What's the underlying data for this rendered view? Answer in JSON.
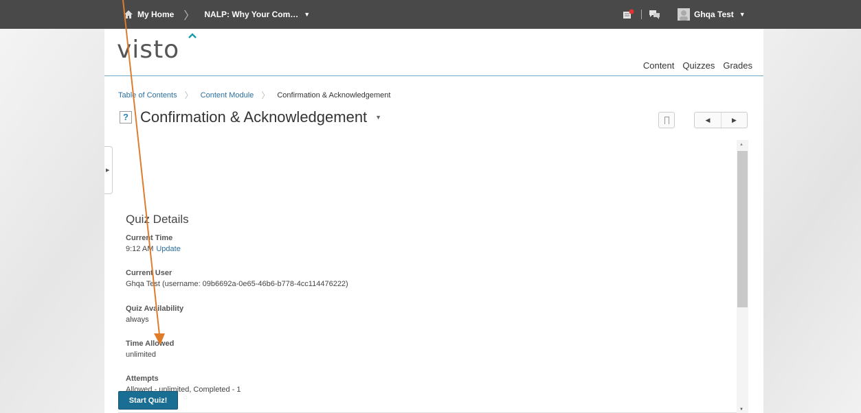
{
  "topbar": {
    "home_label": "My Home",
    "course_label": "NALP: Why Your Com…",
    "user_name": "Ghqa Test"
  },
  "logo": {
    "text": "visto"
  },
  "nav": {
    "items": [
      "Content",
      "Quizzes",
      "Grades"
    ]
  },
  "breadcrumb": {
    "items": [
      "Table of Contents",
      "Content Module"
    ],
    "current": "Confirmation & Acknowledgement"
  },
  "page": {
    "title": "Confirmation & Acknowledgement",
    "icon_glyph": "?"
  },
  "quiz": {
    "heading": "Quiz Details",
    "current_time": {
      "label": "Current Time",
      "value": "9:12 AM",
      "link": "Update"
    },
    "current_user": {
      "label": "Current User",
      "value": "Ghqa Test (username: 09b6692a-0e65-46b6-b778-4cc114476222)"
    },
    "availability": {
      "label": "Quiz Availability",
      "value": "always"
    },
    "time_allowed": {
      "label": "Time Allowed",
      "value": "unlimited"
    },
    "attempts": {
      "label": "Attempts",
      "value": "Allowed - unlimited, Completed - 1"
    },
    "start_label": "Start Quiz!"
  },
  "colors": {
    "topbar": "#494949",
    "accent": "#1a6e94",
    "link": "#2a6e9e",
    "annotation": "#e07b2a"
  },
  "icons": [
    "home-icon",
    "alert-icon",
    "chat-icon",
    "avatar",
    "quiz-icon",
    "bookmark-icon",
    "prev-icon",
    "next-icon"
  ]
}
